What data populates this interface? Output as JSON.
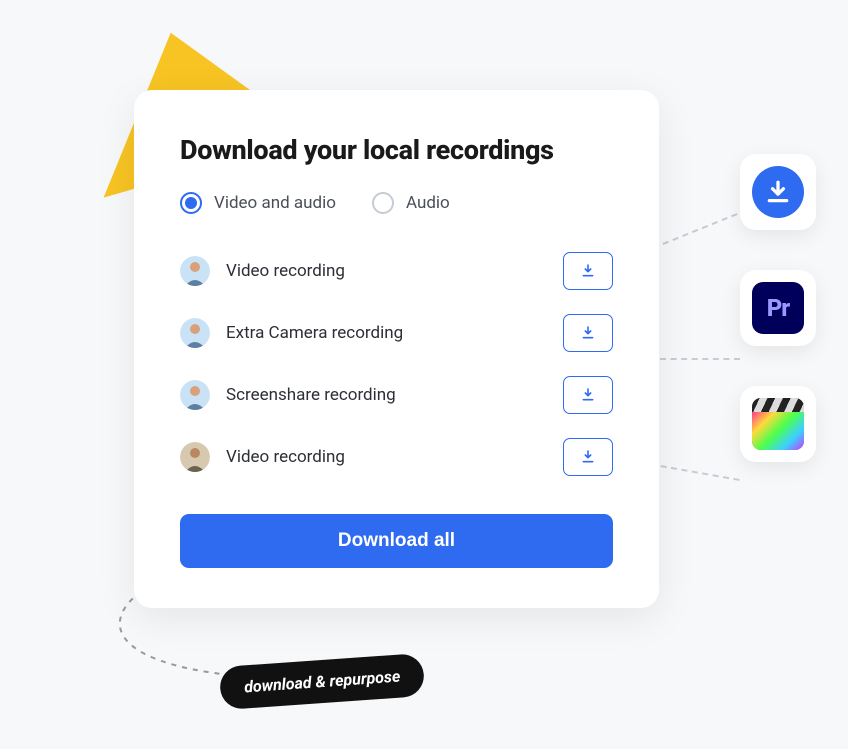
{
  "title": "Download your local recordings",
  "radios": {
    "option1": "Video and audio",
    "option2": "Audio",
    "selected": 0
  },
  "recordings": [
    {
      "label": "Video recording"
    },
    {
      "label": "Extra Camera recording"
    },
    {
      "label": "Screenshare recording"
    },
    {
      "label": "Video recording"
    }
  ],
  "download_all_label": "Download all",
  "pill_label": "download & repurpose",
  "badges": {
    "premiere_label": "Pr"
  }
}
